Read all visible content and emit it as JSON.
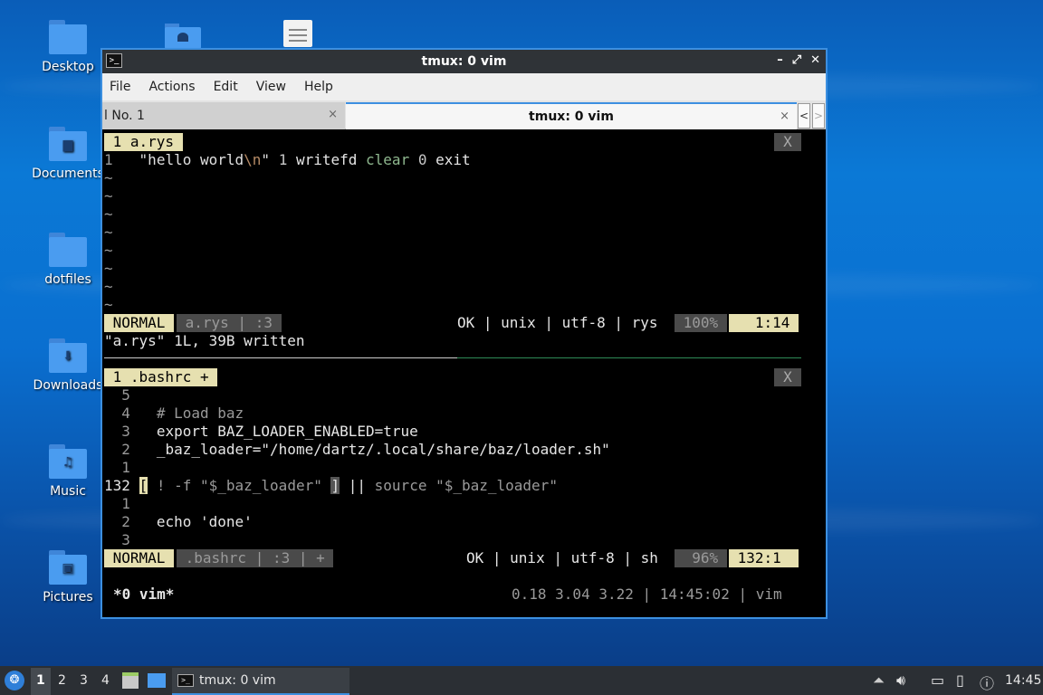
{
  "desktop": {
    "icons": [
      {
        "label": "Desktop"
      },
      {
        "label": "Documents"
      },
      {
        "label": "dotfiles"
      },
      {
        "label": "Downloads"
      },
      {
        "label": "Music"
      },
      {
        "label": "Pictures"
      }
    ]
  },
  "window": {
    "title": "tmux: 0 vim",
    "menu": [
      "File",
      "Actions",
      "Edit",
      "View",
      "Help"
    ],
    "tabs": [
      {
        "label": "l No. 1",
        "close": "×"
      },
      {
        "label": "tmux: 0 vim",
        "close": "×"
      }
    ],
    "tab_nav": {
      "prev": "<",
      "next": ">"
    }
  },
  "pane1": {
    "tab_label": " 1 a.rys ",
    "close": "X",
    "line_no": "1",
    "code": {
      "q1": "\"hello world",
      "esc": "\\n",
      "q2": "\"",
      "sp1": " ",
      "n1": "1",
      "sp2": " writefd ",
      "clear": "clear",
      "sp3": " ",
      "n0": "0",
      "exit": " exit"
    },
    "tilde": "~",
    "status": {
      "mode": " NORMAL ",
      "file": " a.rys | :3 ",
      "right": "OK | unix | utf-8 | rys ",
      "percent": " 100% ",
      "pos": "   1:14 "
    },
    "message": "\"a.rys\" 1L, 39B written"
  },
  "pane2": {
    "tab_label": " 1 .bashrc + ",
    "close": "X",
    "lines": [
      {
        "no": "  5",
        "text": ""
      },
      {
        "no": "  4",
        "text": "# Load baz"
      },
      {
        "no": "  3",
        "text": "export BAZ_LOADER_ENABLED=true"
      },
      {
        "no": "  2",
        "text": "_baz_loader=\"/home/dartz/.local/share/baz/loader.sh\""
      },
      {
        "no": "  1",
        "text": ""
      },
      {
        "no": "132",
        "cursor": "[",
        "text": " ! -f \"$_baz_loader\" ",
        "bracket": "]",
        "text2": " || ",
        "source": "source",
        "text3": " \"$_baz_loader\""
      },
      {
        "no": "  1",
        "text": ""
      },
      {
        "no": "  2",
        "text": "echo 'done'"
      },
      {
        "no": "  3",
        "text": ""
      }
    ],
    "status": {
      "mode": " NORMAL ",
      "file": " .bashrc | :3 | + ",
      "right": "OK | unix | utf-8 | sh ",
      "percent": "  96% ",
      "pos": " 132:1  "
    }
  },
  "tmux_status": {
    "left": "*0 vim*",
    "right": "0.18 3.04 3.22 | 14:45:02 | vim"
  },
  "taskbar": {
    "workspaces": [
      "1",
      "2",
      "3",
      "4"
    ],
    "task_label": "tmux: 0 vim",
    "clock": "14:45"
  }
}
